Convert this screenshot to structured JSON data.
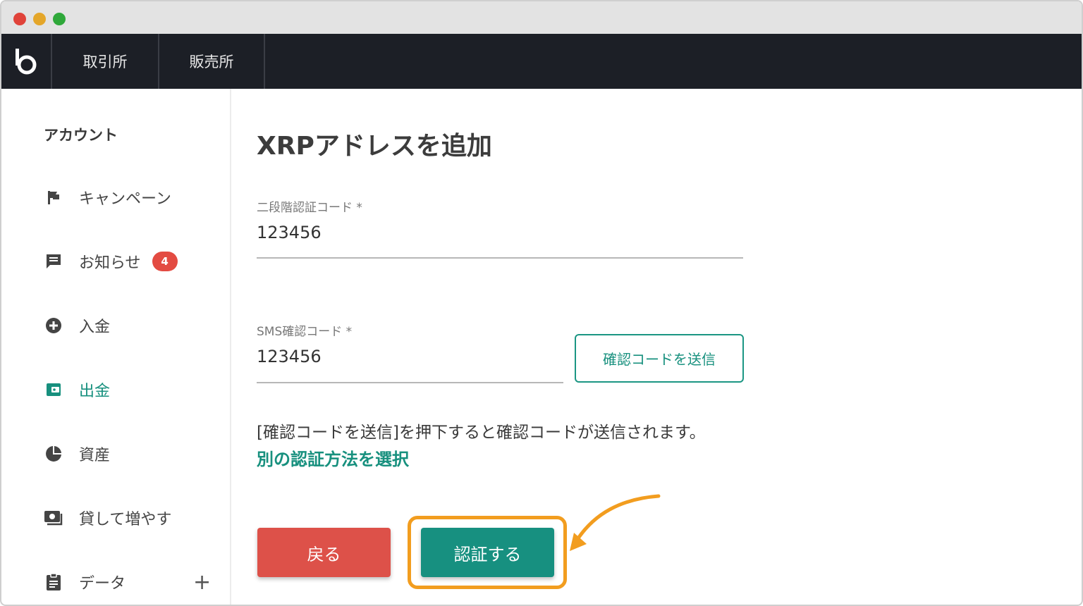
{
  "nav": {
    "tabs": [
      "取引所",
      "販売所"
    ]
  },
  "sidebar": {
    "heading": "アカウント",
    "items": [
      {
        "label": "キャンペーン",
        "icon": "flag-icon"
      },
      {
        "label": "お知らせ",
        "icon": "chat-icon",
        "badge": "4"
      },
      {
        "label": "入金",
        "icon": "plus-circle-icon"
      },
      {
        "label": "出金",
        "icon": "wallet-icon",
        "active": true
      },
      {
        "label": "資産",
        "icon": "pie-chart-icon"
      },
      {
        "label": "貸して増やす",
        "icon": "lending-icon"
      },
      {
        "label": "データ",
        "icon": "clipboard-icon"
      }
    ],
    "expand": "+"
  },
  "main": {
    "title": "XRPアドレスを追加",
    "two_factor": {
      "label": "二段階認証コード *",
      "value": "123456"
    },
    "sms": {
      "label": "SMS確認コード *",
      "value": "123456",
      "send_label": "確認コードを送信"
    },
    "info": "[確認コードを送信]を押下すると確認コードが送信されます。",
    "alt_link": "別の認証方法を選択",
    "back_label": "戻る",
    "auth_label": "認証する"
  },
  "colors": {
    "accent": "#17907e",
    "danger": "#dd5149",
    "highlight": "#f29d1f",
    "nav_bg": "#1c1f26"
  }
}
